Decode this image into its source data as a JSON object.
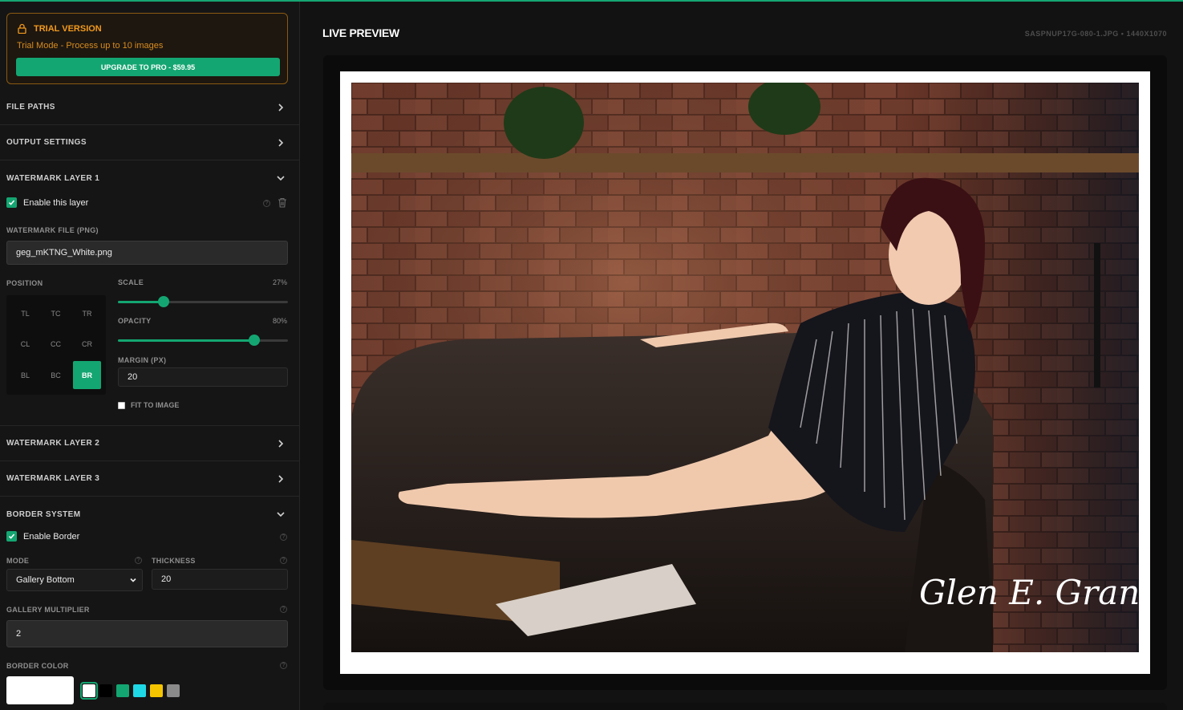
{
  "trial": {
    "title": "TRIAL VERSION",
    "subtitle": "Trial Mode - Process up to 10 images",
    "upgrade_label": "UPGRADE TO PRO - $59.95"
  },
  "sections": {
    "file_paths": "FILE PATHS",
    "output_settings": "OUTPUT SETTINGS",
    "watermark_layer_1": "WATERMARK LAYER 1",
    "watermark_layer_2": "WATERMARK LAYER 2",
    "watermark_layer_3": "WATERMARK LAYER 3",
    "border_system": "BORDER SYSTEM"
  },
  "layer1": {
    "enable_label": "Enable this layer",
    "enabled": true,
    "file_label": "WATERMARK FILE (PNG)",
    "file_value": "geg_mKTNG_White.png",
    "position_label": "POSITION",
    "positions": [
      "TL",
      "TC",
      "TR",
      "CL",
      "CC",
      "CR",
      "BL",
      "BC",
      "BR"
    ],
    "selected_position": "BR",
    "scale_label": "SCALE",
    "scale_value": "27%",
    "scale_fraction": 0.27,
    "opacity_label": "OPACITY",
    "opacity_value": "80%",
    "opacity_fraction": 0.8,
    "margin_label": "MARGIN (PX)",
    "margin_value": "20",
    "fit_label": "FIT TO IMAGE",
    "fit_checked": false
  },
  "border": {
    "enable_label": "Enable Border",
    "enabled": true,
    "mode_label": "MODE",
    "mode_value": "Gallery Bottom",
    "thickness_label": "THICKNESS",
    "thickness_value": "20",
    "multiplier_label": "GALLERY MULTIPLIER",
    "multiplier_value": "2",
    "color_label": "BORDER COLOR",
    "current_color": "#ffffff",
    "swatches": [
      "#ffffff",
      "#000000",
      "#14a672",
      "#1fd8e6",
      "#f5c400",
      "#8a8a8a"
    ]
  },
  "main": {
    "title": "LIVE PREVIEW",
    "file_info": "SASPNUP17G-080-1.JPG • 1440X1070",
    "watermark_text": "Glen E. Grant"
  },
  "colors": {
    "accent": "#14a672",
    "trial_orange": "#f39a1b"
  }
}
